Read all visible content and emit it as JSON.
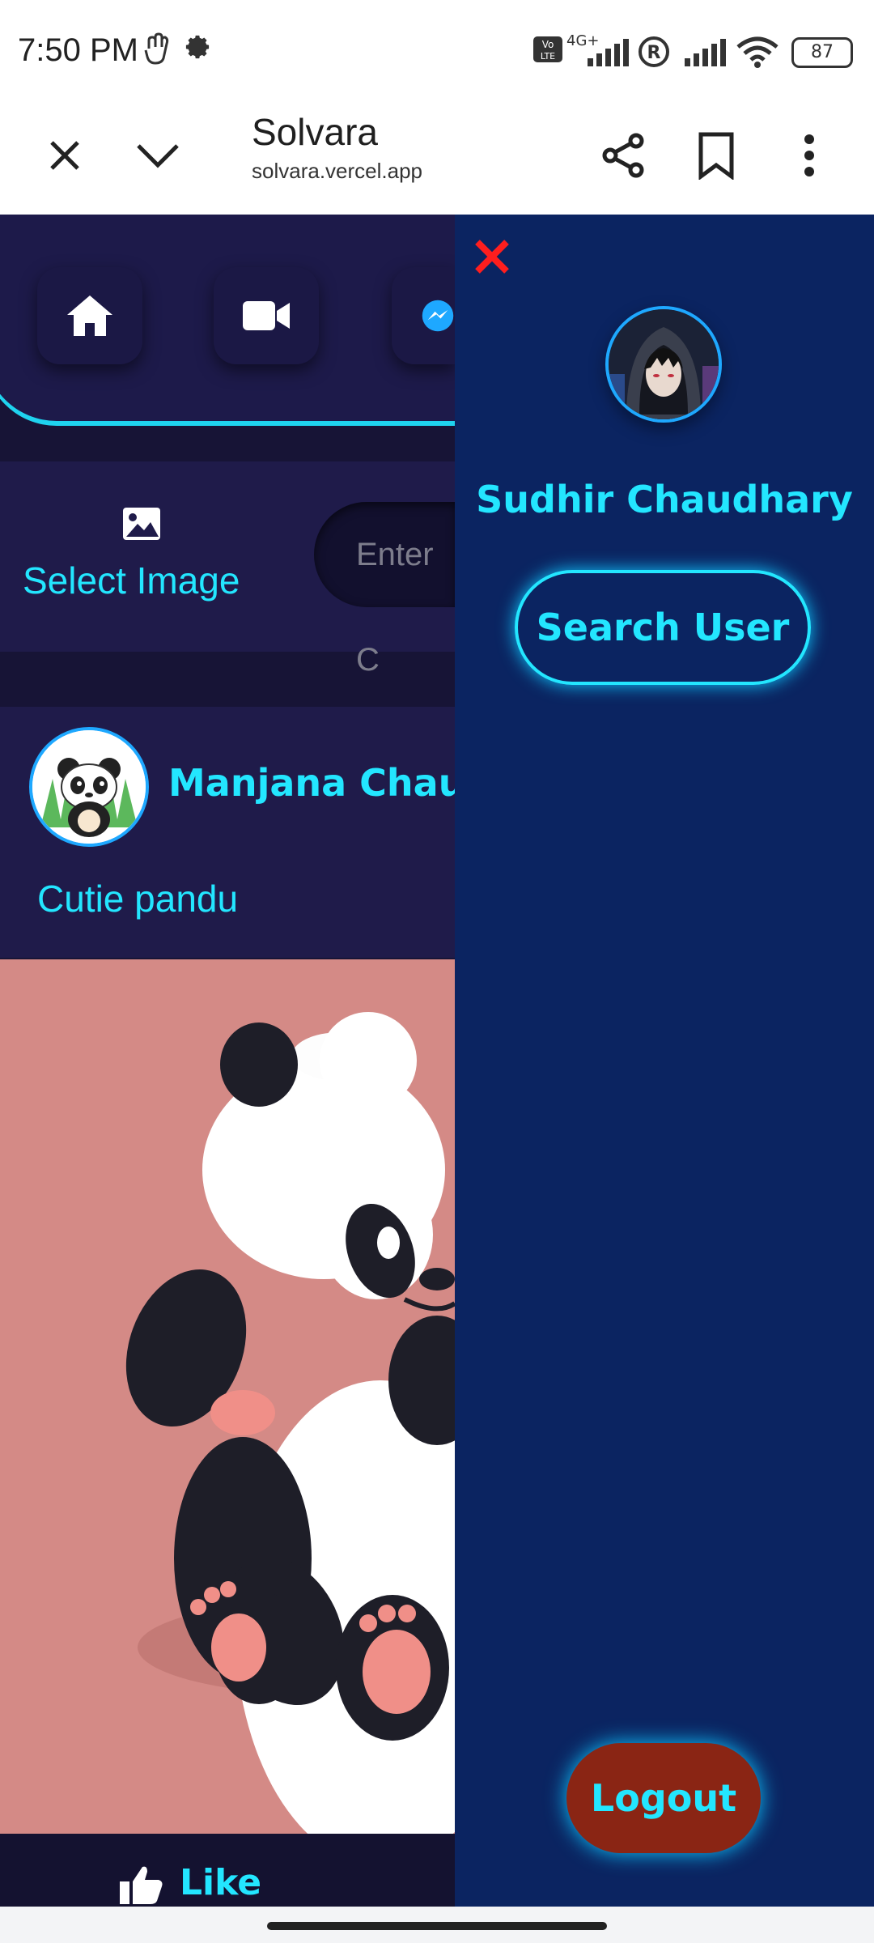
{
  "status_bar": {
    "time": "7:50 PM",
    "network": "4G+",
    "battery": "87",
    "icons": [
      "hand-icon",
      "gear-icon",
      "volte-icon",
      "signal-icon",
      "roaming-icon",
      "signal-icon",
      "wifi-icon",
      "battery-icon"
    ]
  },
  "browser": {
    "title": "Solvara",
    "url": "solvara.vercel.app",
    "icons": [
      "close-icon",
      "chevron-down-icon",
      "share-icon",
      "bookmark-icon",
      "more-vert-icon"
    ]
  },
  "app": {
    "nav_icons": [
      "home-icon",
      "video-icon",
      "messenger-icon"
    ],
    "select_image_label": "Select Image",
    "caption_placeholder": "Enter C",
    "post": {
      "author": "Manjana Chau",
      "caption": "Cutie pandu",
      "like_label": "Like"
    }
  },
  "drawer": {
    "user_name": "Sudhir Chaudhary",
    "search_label": "Search User",
    "logout_label": "Logout"
  },
  "colors": {
    "accent": "#23e6ff",
    "drawer_bg": "#0b2461",
    "app_bg": "#171436",
    "logout_bg": "#8a2514",
    "close_red": "#ff1e1e"
  }
}
